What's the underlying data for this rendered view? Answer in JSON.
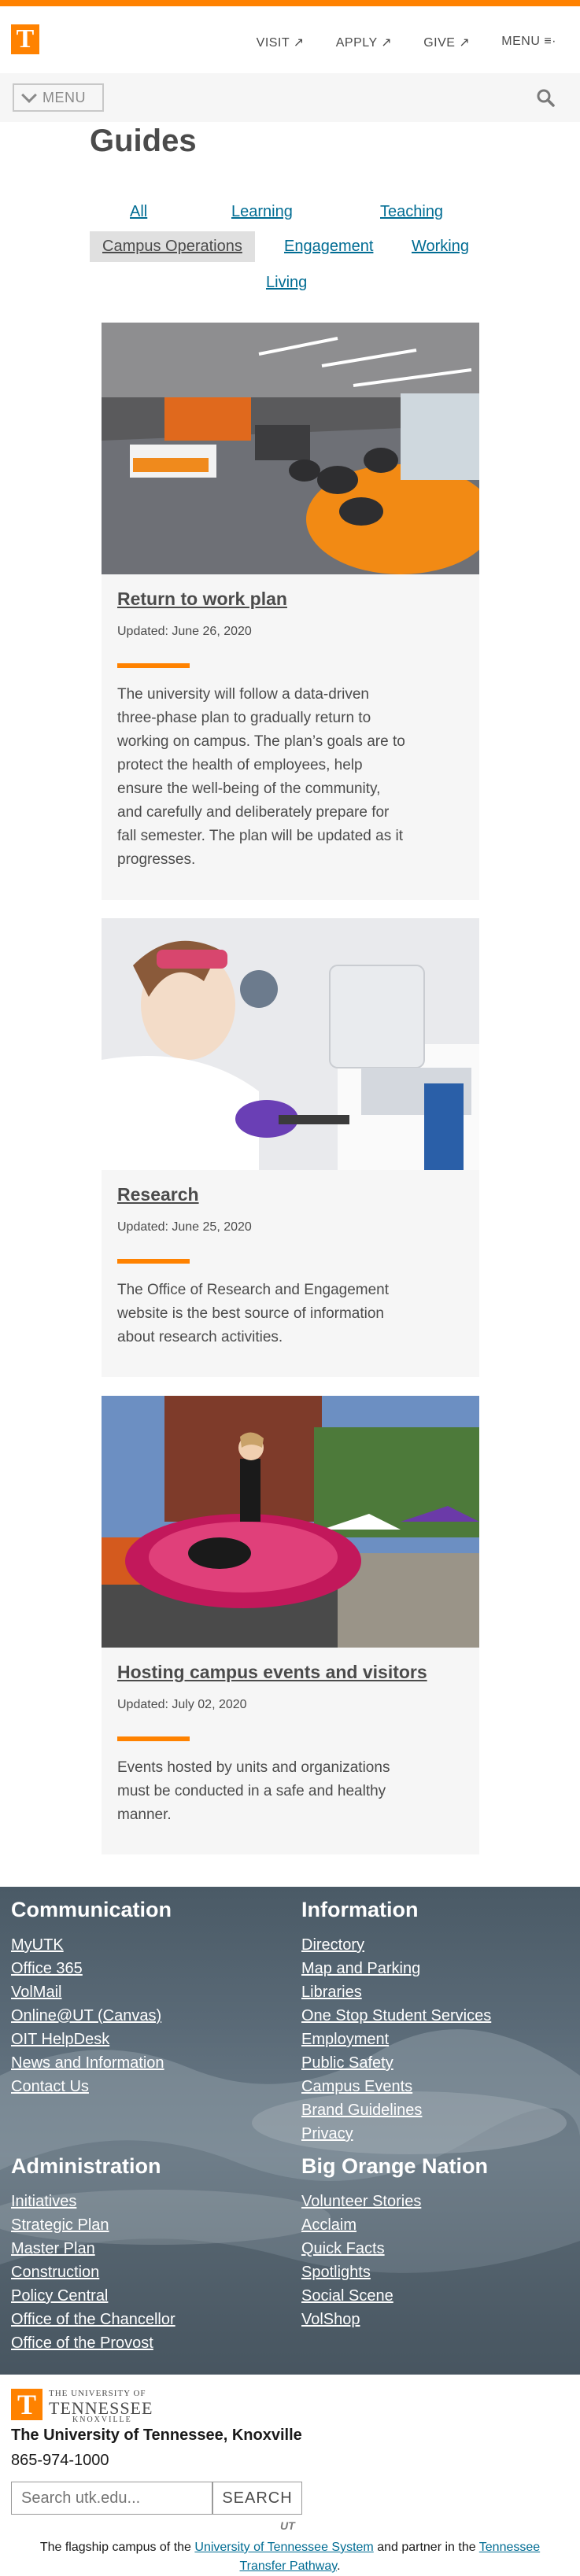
{
  "header": {
    "logo_letter": "T",
    "nav": [
      {
        "label": "VISIT ↗"
      },
      {
        "label": "APPLY ↗"
      },
      {
        "label": "GIVE ↗"
      },
      {
        "label": "MENU ≡·"
      }
    ]
  },
  "menubar": {
    "menu_label": "MENU",
    "icons": {
      "menu": "chevron-down-icon",
      "search": "search-icon"
    }
  },
  "guides": {
    "title": "Guides",
    "filters": [
      "All",
      "Learning",
      "Teaching",
      "Campus Operations",
      "Engagement",
      "Working",
      "Living"
    ],
    "active_filter": "Campus Operations"
  },
  "cards": [
    {
      "title": "Return to work plan",
      "date": "Updated: June 26, 2020",
      "desc_lines": [
        "The university will follow a data-driven",
        "three-phase plan to gradually return to",
        "working on campus. The plan’s goals are to",
        "protect the health of employees, help",
        "ensure the well-being of the community,",
        "and carefully and deliberately prepare for",
        "fall semester. The plan will be updated as it",
        "progresses."
      ]
    },
    {
      "title": "Research",
      "date": "Updated: June 25, 2020",
      "desc_lines": [
        "The Office of Research and Engagement",
        "website is the best source of information",
        "about research activities."
      ]
    },
    {
      "title": "Hosting campus events and visitors",
      "date": "Updated: July 02, 2020",
      "desc_lines": [
        "Events hosted by units and organizations",
        "must be conducted in a safe and healthy",
        "manner."
      ]
    }
  ],
  "footer": {
    "communication": {
      "heading": "Communication",
      "links": [
        "MyUTK",
        "Office 365",
        "VolMail",
        "Online@UT (Canvas)",
        "OIT HelpDesk",
        "News and Information",
        "Contact Us"
      ]
    },
    "information": {
      "heading": "Information",
      "links": [
        "Directory",
        "Map and Parking",
        "Libraries",
        "One Stop Student Services",
        "Employment",
        "Public Safety",
        "Campus Events",
        "Brand Guidelines",
        "Privacy"
      ]
    },
    "administration": {
      "heading": "Administration",
      "links": [
        "Initiatives",
        "Strategic Plan",
        "Master Plan",
        "Construction",
        "Policy Central",
        "Office of the Chancellor",
        "Office of the Provost"
      ]
    },
    "big_orange": {
      "heading": "Big Orange Nation",
      "links": [
        "Volunteer Stories",
        "Acclaim",
        "Quick Facts",
        "Spotlights",
        "Social Scene",
        "VolShop"
      ]
    }
  },
  "bottom": {
    "logo_letter": "T",
    "wordmark_small": "THE UNIVERSITY OF",
    "wordmark_big": "TENNESSEE",
    "wordmark_loc": "KNOXVILLE",
    "name": "The University of Tennessee, Knoxville",
    "phone": "865-974-1000",
    "search_placeholder": "Search utk.edu...",
    "search_button": "SEARCH",
    "ut_mark": "UT",
    "flagship_pre": "The flagship campus of the ",
    "flagship_link1": "University of Tennessee System",
    "flagship_mid": " and partner in the ",
    "flagship_link2": "Tennessee Transfer Pathway",
    "flagship_post": "."
  },
  "colors": {
    "orange": "#ff8200",
    "link": "#006c93",
    "text": "#4b4b4b"
  }
}
